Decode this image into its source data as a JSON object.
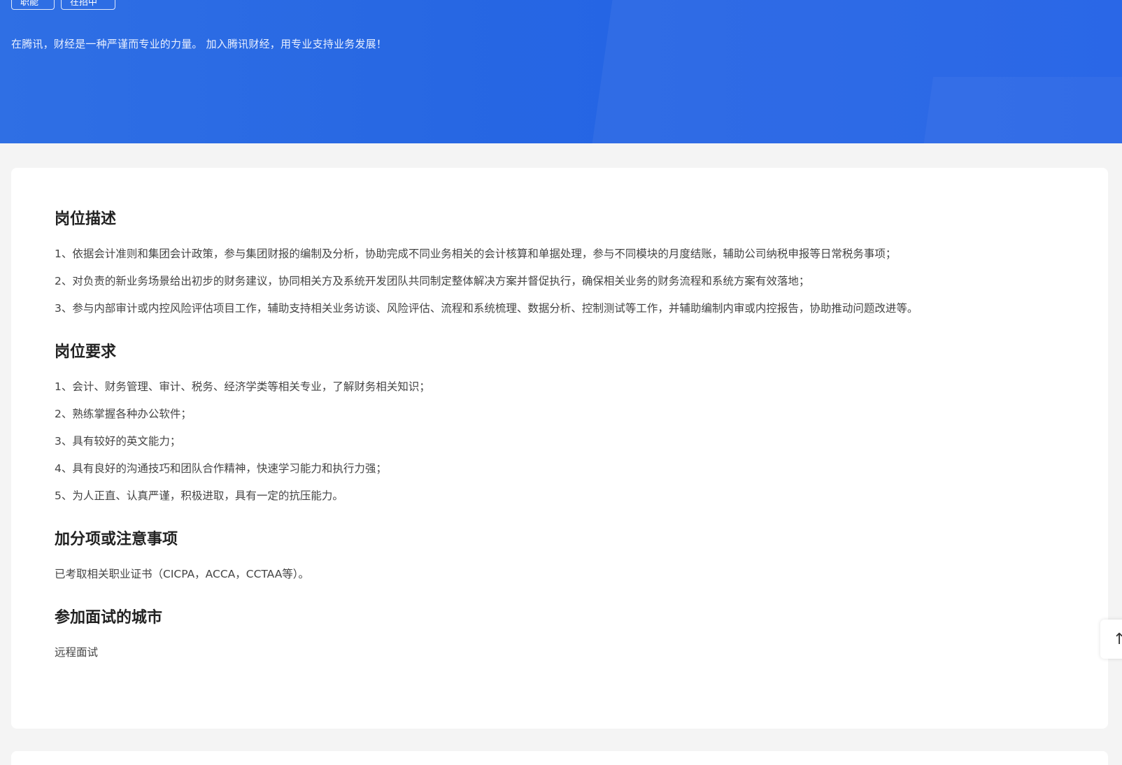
{
  "banner": {
    "tags": [
      "职能",
      "在招中"
    ],
    "slogan": "在腾讯，财经是一种严谨而专业的力量。 加入腾讯财经，用专业支持业务发展！",
    "color": "#2767e3"
  },
  "sections": [
    {
      "title": "岗位描述",
      "lines": [
        "1、依据会计准则和集团会计政策，参与集团财报的编制及分析，协助完成不同业务相关的会计核算和单据处理，参与不同模块的月度结账，辅助公司纳税申报等日常税务事项；",
        "2、对负责的新业务场景给出初步的财务建议，协同相关方及系统开发团队共同制定整体解决方案并督促执行，确保相关业务的财务流程和系统方案有效落地；",
        "3、参与内部审计或内控风险评估项目工作，辅助支持相关业务访谈、风险评估、流程和系统梳理、数据分析、控制测试等工作，并辅助编制内审或内控报告，协助推动问题改进等。"
      ]
    },
    {
      "title": "岗位要求",
      "lines": [
        "1、会计、财务管理、审计、税务、经济学类等相关专业，了解财务相关知识；",
        "2、熟练掌握各种办公软件；",
        "3、具有较好的英文能力；",
        "4、具有良好的沟通技巧和团队合作精神，快速学习能力和执行力强；",
        "5、为人正直、认真严谨，积极进取，具有一定的抗压能力。"
      ]
    },
    {
      "title": "加分项或注意事项",
      "lines": [
        "已考取相关职业证书（CICPA，ACCA，CCTAA等）。"
      ]
    },
    {
      "title": "参加面试的城市",
      "lines": [
        "远程面试"
      ]
    }
  ],
  "back_to_top": {
    "icon": "arrow-up-icon",
    "glyph": "↑"
  }
}
